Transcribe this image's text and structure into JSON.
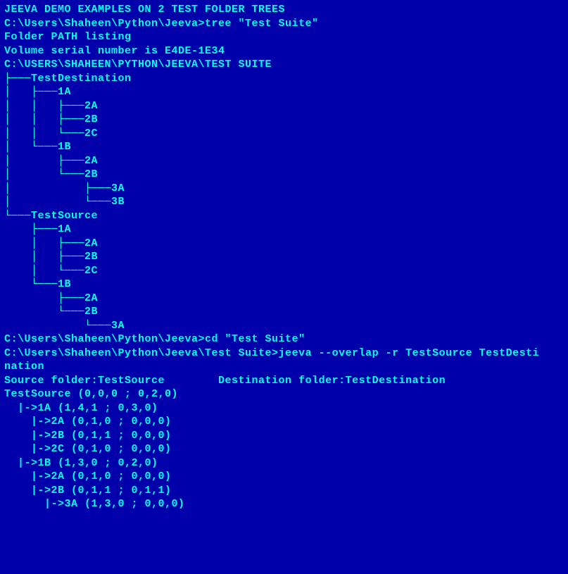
{
  "lines": [
    "JEEVA DEMO EXAMPLES ON 2 TEST FOLDER TREES",
    "",
    "C:\\Users\\Shaheen\\Python\\Jeeva>tree \"Test Suite\"",
    "Folder PATH listing",
    "Volume serial number is E4DE-1E34",
    "C:\\USERS\\SHAHEEN\\PYTHON\\JEEVA\\TEST SUITE",
    "├───TestDestination",
    "│   ├───1A",
    "│   │   ├───2A",
    "│   │   ├───2B",
    "│   │   └───2C",
    "│   └───1B",
    "│       ├───2A",
    "│       └───2B",
    "│           ├───3A",
    "│           └───3B",
    "└───TestSource",
    "    ├───1A",
    "    │   ├───2A",
    "    │   ├───2B",
    "    │   └───2C",
    "    └───1B",
    "        ├───2A",
    "        └───2B",
    "            └───3A",
    "",
    "C:\\Users\\Shaheen\\Python\\Jeeva>cd \"Test Suite\"",
    "",
    "C:\\Users\\Shaheen\\Python\\Jeeva\\Test Suite>jeeva --overlap -r TestSource TestDesti",
    "nation",
    "Source folder:TestSource        Destination folder:TestDestination",
    "TestSource (0,0,0 ; 0,2,0)",
    "  |->1A (1,4,1 ; 0,3,0)",
    "    |->2A (0,1,0 ; 0,0,0)",
    "    |->2B (0,1,1 ; 0,0,0)",
    "    |->2C (0,1,0 ; 0,0,0)",
    "  |->1B (1,3,0 ; 0,2,0)",
    "    |->2A (0,1,0 ; 0,0,0)",
    "    |->2B (0,1,1 ; 0,1,1)",
    "      |->3A (1,3,0 ; 0,0,0)"
  ]
}
